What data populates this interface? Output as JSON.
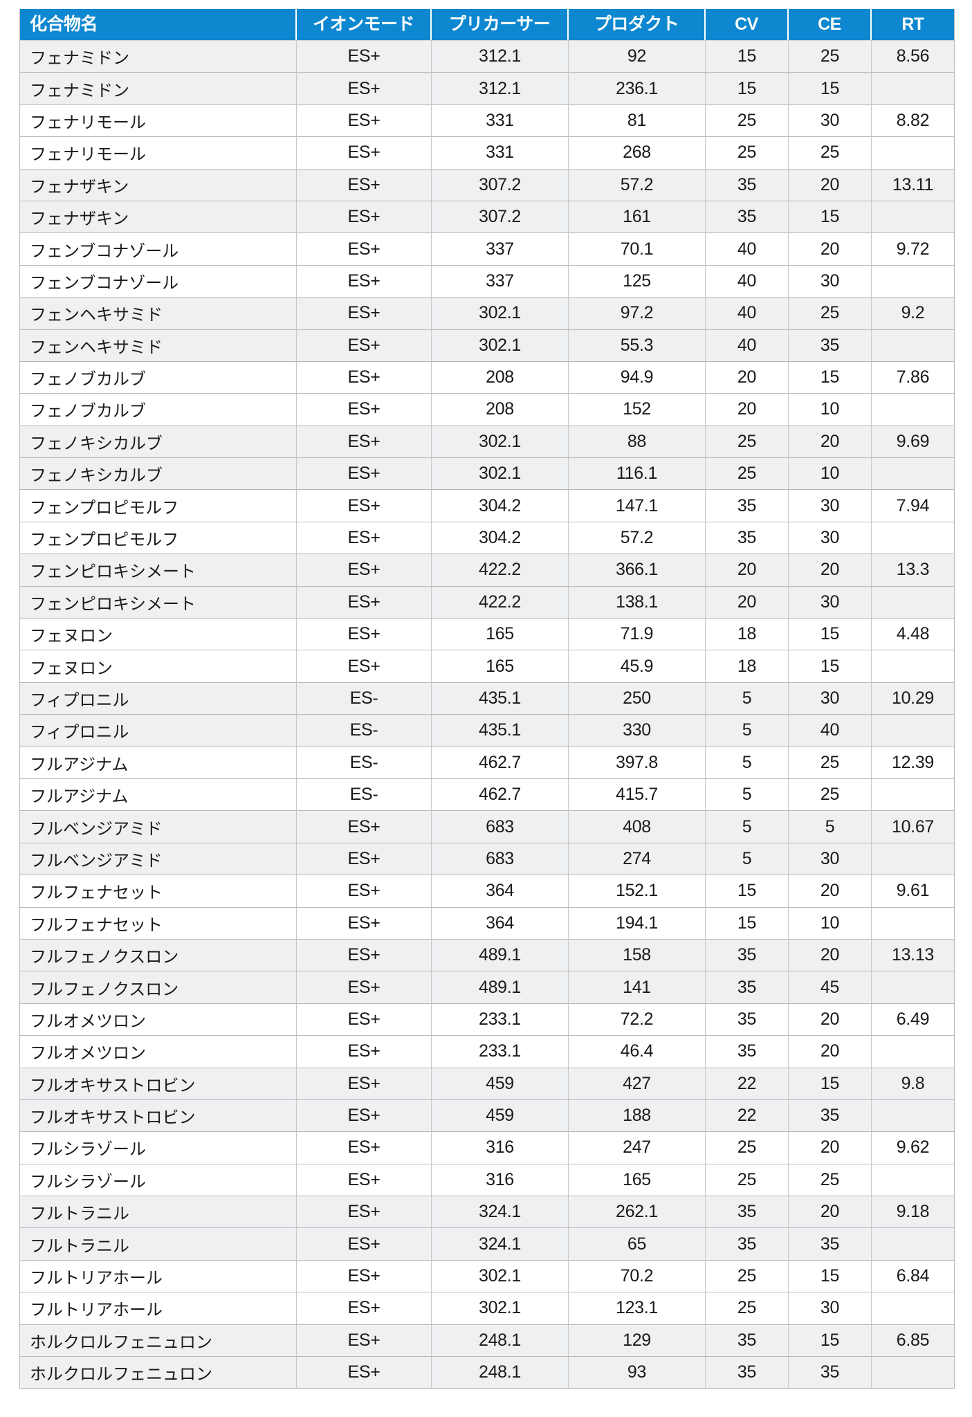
{
  "table": {
    "columns": [
      {
        "key": "compound",
        "label": "化合物名",
        "align": "left"
      },
      {
        "key": "ion_mode",
        "label": "イオンモード",
        "align": "center"
      },
      {
        "key": "precursor",
        "label": "プリカーサー",
        "align": "center"
      },
      {
        "key": "product",
        "label": "プロダクト",
        "align": "center"
      },
      {
        "key": "cv",
        "label": "CV",
        "align": "center"
      },
      {
        "key": "ce",
        "label": "CE",
        "align": "center"
      },
      {
        "key": "rt",
        "label": "RT",
        "align": "center"
      }
    ],
    "header_background": "#0d87cf",
    "header_text_color": "#ffffff",
    "shaded_row_background": "#eef0f2",
    "plain_row_background": "#ffffff",
    "rows": [
      {
        "compound": "フェナミドン",
        "ion_mode": "ES+",
        "precursor": "312.1",
        "product": "92",
        "cv": "15",
        "ce": "25",
        "rt": "8.56",
        "shade": true
      },
      {
        "compound": "フェナミドン",
        "ion_mode": "ES+",
        "precursor": "312.1",
        "product": "236.1",
        "cv": "15",
        "ce": "15",
        "rt": "",
        "shade": true
      },
      {
        "compound": "フェナリモール",
        "ion_mode": "ES+",
        "precursor": "331",
        "product": "81",
        "cv": "25",
        "ce": "30",
        "rt": "8.82",
        "shade": false
      },
      {
        "compound": "フェナリモール",
        "ion_mode": "ES+",
        "precursor": "331",
        "product": "268",
        "cv": "25",
        "ce": "25",
        "rt": "",
        "shade": false
      },
      {
        "compound": "フェナザキン",
        "ion_mode": "ES+",
        "precursor": "307.2",
        "product": "57.2",
        "cv": "35",
        "ce": "20",
        "rt": "13.11",
        "shade": true
      },
      {
        "compound": "フェナザキン",
        "ion_mode": "ES+",
        "precursor": "307.2",
        "product": "161",
        "cv": "35",
        "ce": "15",
        "rt": "",
        "shade": true
      },
      {
        "compound": "フェンブコナゾール",
        "ion_mode": "ES+",
        "precursor": "337",
        "product": "70.1",
        "cv": "40",
        "ce": "20",
        "rt": "9.72",
        "shade": false
      },
      {
        "compound": "フェンブコナゾール",
        "ion_mode": "ES+",
        "precursor": "337",
        "product": "125",
        "cv": "40",
        "ce": "30",
        "rt": "",
        "shade": false
      },
      {
        "compound": "フェンヘキサミド",
        "ion_mode": "ES+",
        "precursor": "302.1",
        "product": "97.2",
        "cv": "40",
        "ce": "25",
        "rt": "9.2",
        "shade": true
      },
      {
        "compound": "フェンヘキサミド",
        "ion_mode": "ES+",
        "precursor": "302.1",
        "product": "55.3",
        "cv": "40",
        "ce": "35",
        "rt": "",
        "shade": true
      },
      {
        "compound": "フェノブカルブ",
        "ion_mode": "ES+",
        "precursor": "208",
        "product": "94.9",
        "cv": "20",
        "ce": "15",
        "rt": "7.86",
        "shade": false
      },
      {
        "compound": "フェノブカルブ",
        "ion_mode": "ES+",
        "precursor": "208",
        "product": "152",
        "cv": "20",
        "ce": "10",
        "rt": "",
        "shade": false
      },
      {
        "compound": "フェノキシカルブ",
        "ion_mode": "ES+",
        "precursor": "302.1",
        "product": "88",
        "cv": "25",
        "ce": "20",
        "rt": "9.69",
        "shade": true
      },
      {
        "compound": "フェノキシカルブ",
        "ion_mode": "ES+",
        "precursor": "302.1",
        "product": "116.1",
        "cv": "25",
        "ce": "10",
        "rt": "",
        "shade": true
      },
      {
        "compound": "フェンプロピモルフ",
        "ion_mode": "ES+",
        "precursor": "304.2",
        "product": "147.1",
        "cv": "35",
        "ce": "30",
        "rt": "7.94",
        "shade": false
      },
      {
        "compound": "フェンプロピモルフ",
        "ion_mode": "ES+",
        "precursor": "304.2",
        "product": "57.2",
        "cv": "35",
        "ce": "30",
        "rt": "",
        "shade": false
      },
      {
        "compound": "フェンピロキシメート",
        "ion_mode": "ES+",
        "precursor": "422.2",
        "product": "366.1",
        "cv": "20",
        "ce": "20",
        "rt": "13.3",
        "shade": true
      },
      {
        "compound": "フェンピロキシメート",
        "ion_mode": "ES+",
        "precursor": "422.2",
        "product": "138.1",
        "cv": "20",
        "ce": "30",
        "rt": "",
        "shade": true
      },
      {
        "compound": "フェヌロン",
        "ion_mode": "ES+",
        "precursor": "165",
        "product": "71.9",
        "cv": "18",
        "ce": "15",
        "rt": "4.48",
        "shade": false
      },
      {
        "compound": "フェヌロン",
        "ion_mode": "ES+",
        "precursor": "165",
        "product": "45.9",
        "cv": "18",
        "ce": "15",
        "rt": "",
        "shade": false
      },
      {
        "compound": "フィプロニル",
        "ion_mode": "ES-",
        "precursor": "435.1",
        "product": "250",
        "cv": "5",
        "ce": "30",
        "rt": "10.29",
        "shade": true
      },
      {
        "compound": "フィプロニル",
        "ion_mode": "ES-",
        "precursor": "435.1",
        "product": "330",
        "cv": "5",
        "ce": "40",
        "rt": "",
        "shade": true
      },
      {
        "compound": "フルアジナム",
        "ion_mode": "ES-",
        "precursor": "462.7",
        "product": "397.8",
        "cv": "5",
        "ce": "25",
        "rt": "12.39",
        "shade": false
      },
      {
        "compound": "フルアジナム",
        "ion_mode": "ES-",
        "precursor": "462.7",
        "product": "415.7",
        "cv": "5",
        "ce": "25",
        "rt": "",
        "shade": false
      },
      {
        "compound": "フルベンジアミド",
        "ion_mode": "ES+",
        "precursor": "683",
        "product": "408",
        "cv": "5",
        "ce": "5",
        "rt": "10.67",
        "shade": true
      },
      {
        "compound": "フルベンジアミド",
        "ion_mode": "ES+",
        "precursor": "683",
        "product": "274",
        "cv": "5",
        "ce": "30",
        "rt": "",
        "shade": true
      },
      {
        "compound": "フルフェナセット",
        "ion_mode": "ES+",
        "precursor": "364",
        "product": "152.1",
        "cv": "15",
        "ce": "20",
        "rt": "9.61",
        "shade": false
      },
      {
        "compound": "フルフェナセット",
        "ion_mode": "ES+",
        "precursor": "364",
        "product": "194.1",
        "cv": "15",
        "ce": "10",
        "rt": "",
        "shade": false
      },
      {
        "compound": "フルフェノクスロン",
        "ion_mode": "ES+",
        "precursor": "489.1",
        "product": "158",
        "cv": "35",
        "ce": "20",
        "rt": "13.13",
        "shade": true
      },
      {
        "compound": "フルフェノクスロン",
        "ion_mode": "ES+",
        "precursor": "489.1",
        "product": "141",
        "cv": "35",
        "ce": "45",
        "rt": "",
        "shade": true
      },
      {
        "compound": "フルオメツロン",
        "ion_mode": "ES+",
        "precursor": "233.1",
        "product": "72.2",
        "cv": "35",
        "ce": "20",
        "rt": "6.49",
        "shade": false
      },
      {
        "compound": "フルオメツロン",
        "ion_mode": "ES+",
        "precursor": "233.1",
        "product": "46.4",
        "cv": "35",
        "ce": "20",
        "rt": "",
        "shade": false
      },
      {
        "compound": "フルオキサストロビン",
        "ion_mode": "ES+",
        "precursor": "459",
        "product": "427",
        "cv": "22",
        "ce": "15",
        "rt": "9.8",
        "shade": true
      },
      {
        "compound": "フルオキサストロビン",
        "ion_mode": "ES+",
        "precursor": "459",
        "product": "188",
        "cv": "22",
        "ce": "35",
        "rt": "",
        "shade": true
      },
      {
        "compound": "フルシラゾール",
        "ion_mode": "ES+",
        "precursor": "316",
        "product": "247",
        "cv": "25",
        "ce": "20",
        "rt": "9.62",
        "shade": false
      },
      {
        "compound": "フルシラゾール",
        "ion_mode": "ES+",
        "precursor": "316",
        "product": "165",
        "cv": "25",
        "ce": "25",
        "rt": "",
        "shade": false
      },
      {
        "compound": "フルトラニル",
        "ion_mode": "ES+",
        "precursor": "324.1",
        "product": "262.1",
        "cv": "35",
        "ce": "20",
        "rt": "9.18",
        "shade": true
      },
      {
        "compound": "フルトラニル",
        "ion_mode": "ES+",
        "precursor": "324.1",
        "product": "65",
        "cv": "35",
        "ce": "35",
        "rt": "",
        "shade": true
      },
      {
        "compound": "フルトリアホール",
        "ion_mode": "ES+",
        "precursor": "302.1",
        "product": "70.2",
        "cv": "25",
        "ce": "15",
        "rt": "6.84",
        "shade": false
      },
      {
        "compound": "フルトリアホール",
        "ion_mode": "ES+",
        "precursor": "302.1",
        "product": "123.1",
        "cv": "25",
        "ce": "30",
        "rt": "",
        "shade": false
      },
      {
        "compound": "ホルクロルフェニュロン",
        "ion_mode": "ES+",
        "precursor": "248.1",
        "product": "129",
        "cv": "35",
        "ce": "15",
        "rt": "6.85",
        "shade": true
      },
      {
        "compound": "ホルクロルフェニュロン",
        "ion_mode": "ES+",
        "precursor": "248.1",
        "product": "93",
        "cv": "35",
        "ce": "35",
        "rt": "",
        "shade": true
      }
    ]
  }
}
